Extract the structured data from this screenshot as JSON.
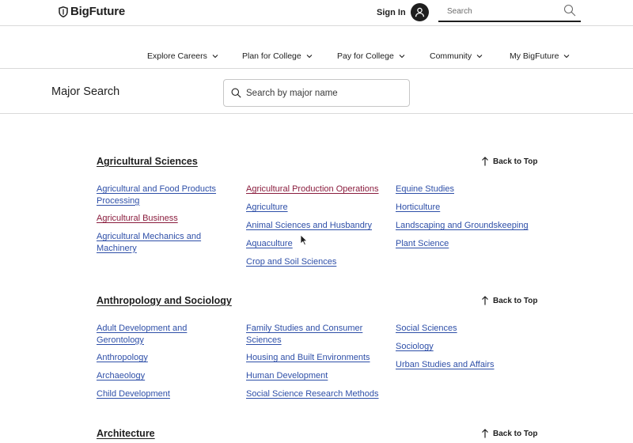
{
  "header": {
    "logo_text": "BigFuture",
    "signin_label": "Sign In",
    "search_placeholder": "Search"
  },
  "nav": [
    {
      "label": "Explore Careers"
    },
    {
      "label": "Plan for College"
    },
    {
      "label": "Pay for College"
    },
    {
      "label": "Community"
    },
    {
      "label": "My BigFuture"
    }
  ],
  "major_search": {
    "title": "Major Search",
    "placeholder": "Search by major name"
  },
  "back_to_top_label": "Back to Top",
  "sections": [
    {
      "title": "Agricultural Sciences",
      "links": [
        {
          "text": "Agricultural and Food Products Processing",
          "visited": false
        },
        {
          "text": "Agricultural Business",
          "visited": true
        },
        {
          "text": "Agricultural Mechanics and Machinery",
          "visited": false
        },
        {
          "text": "Agricultural Production Operations",
          "visited": true
        },
        {
          "text": "Agriculture",
          "visited": false
        },
        {
          "text": "Animal Sciences and Husbandry",
          "visited": false
        },
        {
          "text": "Aquaculture",
          "visited": false
        },
        {
          "text": "Crop and Soil Sciences",
          "visited": false
        },
        {
          "text": "Equine Studies",
          "visited": false
        },
        {
          "text": "Horticulture",
          "visited": false
        },
        {
          "text": "Landscaping and Groundskeeping",
          "visited": false
        },
        {
          "text": "Plant Science",
          "visited": false
        }
      ]
    },
    {
      "title": "Anthropology and Sociology",
      "links": [
        {
          "text": "Adult Development and Gerontology",
          "visited": false
        },
        {
          "text": "Anthropology",
          "visited": false
        },
        {
          "text": "Archaeology",
          "visited": false
        },
        {
          "text": "Child Development",
          "visited": false
        },
        {
          "text": "Family Studies and Consumer Sciences",
          "visited": false
        },
        {
          "text": "Housing and Built Environments",
          "visited": false
        },
        {
          "text": "Human Development",
          "visited": false
        },
        {
          "text": "Social Science Research Methods",
          "visited": false
        },
        {
          "text": "Social Sciences",
          "visited": false
        },
        {
          "text": "Sociology",
          "visited": false
        },
        {
          "text": "Urban Studies and Affairs",
          "visited": false
        }
      ]
    },
    {
      "title": "Architecture",
      "links": []
    }
  ],
  "colors": {
    "link": "#2e4fa8",
    "visited_link": "#8a1c3d",
    "text": "#1e1e1e",
    "divider": "#d9d9d9"
  },
  "icons": [
    "shield-logo-icon",
    "user-icon",
    "search-icon",
    "chevron-down-icon",
    "arrow-up-icon",
    "cursor-icon"
  ]
}
